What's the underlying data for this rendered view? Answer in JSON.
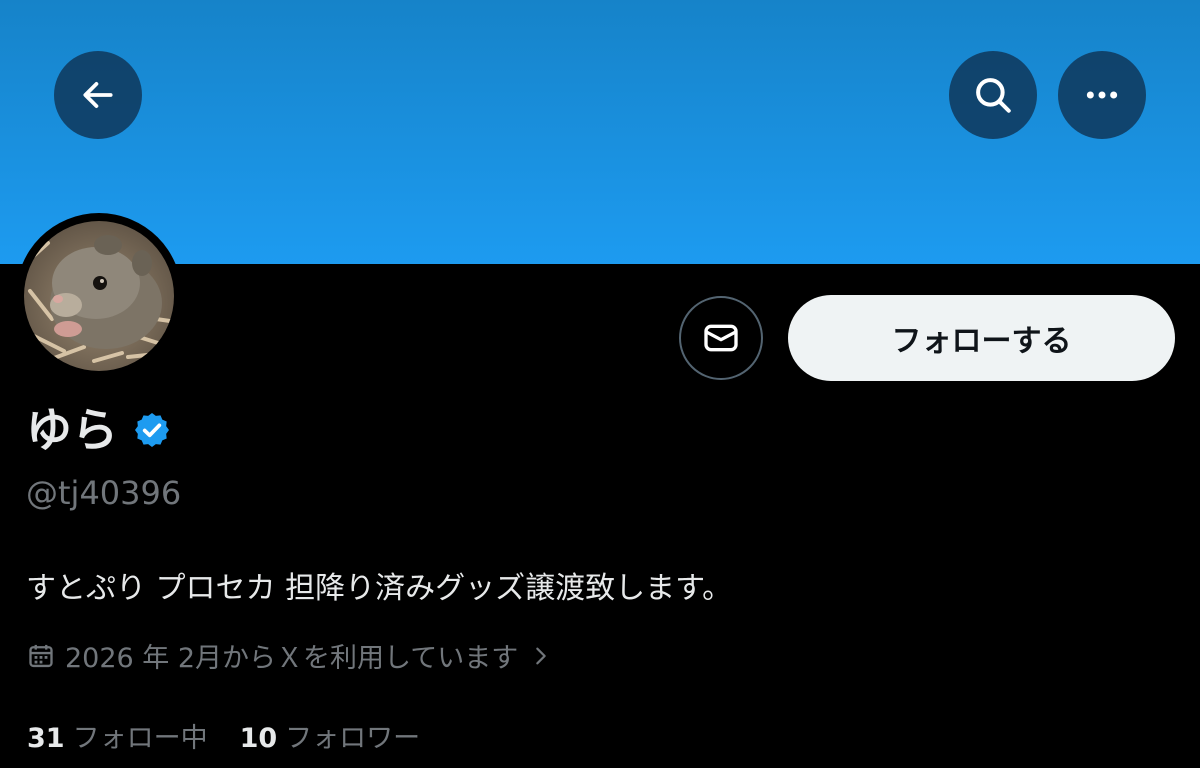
{
  "profile": {
    "display_name": "ゆら",
    "handle": "@tj40396",
    "bio": "すとぷり プロセカ 担降り済みグッズ譲渡致します。",
    "joined": "2026 年 2月からＸを利用しています",
    "following_count": "31",
    "following_label": "フォロー中",
    "followers_count": "10",
    "followers_label": "フォロワー"
  },
  "actions": {
    "follow_label": "フォローする"
  },
  "icons": {
    "back": "arrow-left-icon",
    "search": "search-icon",
    "more": "more-horizontal-icon",
    "mail": "mail-icon",
    "verified": "verified-badge-icon",
    "calendar": "calendar-icon",
    "chevron": "chevron-right-icon"
  },
  "colors": {
    "banner": "#1d9bf0",
    "background": "#000000",
    "verified": "#1d9bf0",
    "follow_button_bg": "#eff3f4",
    "secondary_text": "#71767b"
  }
}
